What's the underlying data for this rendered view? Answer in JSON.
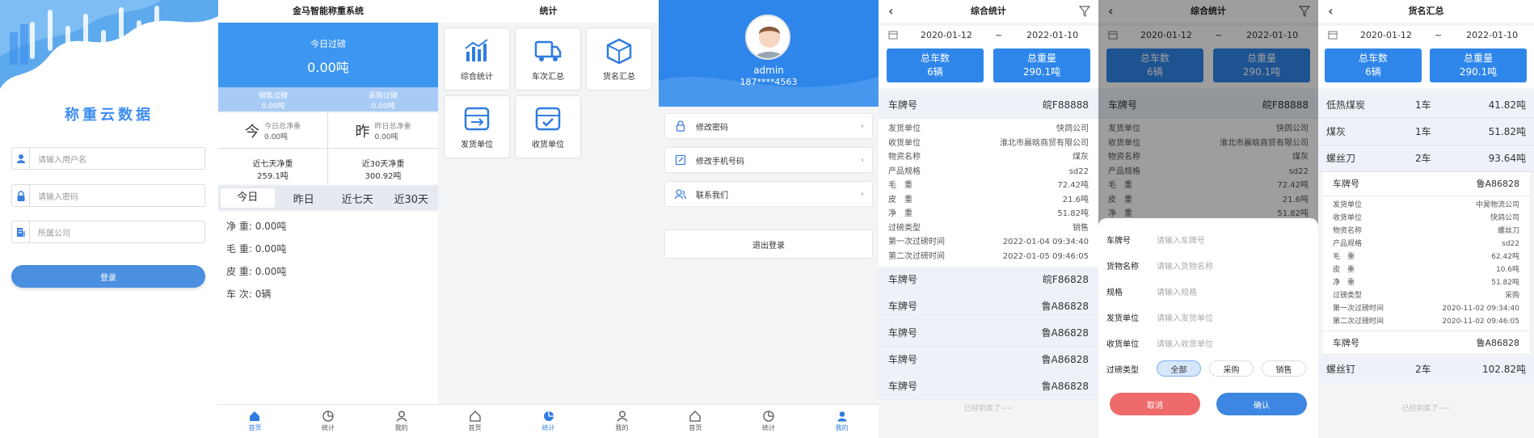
{
  "login": {
    "app_name": "称重云数据",
    "username_placeholder": "请输入用户名",
    "password_placeholder": "请输入密码",
    "company_placeholder": "所属公司",
    "login_button": "登录"
  },
  "home": {
    "title": "金马智能称重系统",
    "today_label": "今日过磅",
    "today_value": "0.00吨",
    "sales_label": "销售过磅",
    "sales_value": "0.00吨",
    "purchase_label": "采购过磅",
    "purchase_value": "0.00吨",
    "jin": "今",
    "today_net_label": "今日总净重",
    "today_net_value": "0.00吨",
    "zuo": "昨",
    "yest_net_label": "昨日总净重",
    "yest_net_value": "0.00吨",
    "week_net_label": "近七天净重",
    "week_net_value": "259.1吨",
    "month_net_label": "近30天净重",
    "month_net_value": "300.92吨",
    "tabs": [
      "今日",
      "昨日",
      "近七天",
      "近30天"
    ],
    "stats": [
      {
        "label": "净 重:",
        "value": "0.00吨"
      },
      {
        "label": "毛 重:",
        "value": "0.00吨"
      },
      {
        "label": "皮 重:",
        "value": "0.00吨"
      },
      {
        "label": "车 次:",
        "value": "0辆"
      }
    ]
  },
  "tabbar": {
    "home": "首页",
    "stats": "统计",
    "mine": "我的"
  },
  "stats_page": {
    "title": "统计",
    "cards": [
      "综合统计",
      "车次汇总",
      "货名汇总",
      "发货单位",
      "收货单位"
    ]
  },
  "profile": {
    "name": "admin",
    "phone": "187****4563",
    "menu": [
      "修改密码",
      "修改手机号码",
      "联系我们"
    ],
    "logout": "退出登录"
  },
  "overall": {
    "title": "综合统计",
    "date_start": "2020-01-12",
    "date_sep": "~",
    "date_end": "2022-01-10",
    "total_cars_label": "总车数",
    "total_cars_value": "6辆",
    "total_weight_label": "总重量",
    "total_weight_value": "290.1吨",
    "plate_label": "车牌号",
    "first_plate": "皖F88888",
    "details": [
      {
        "k": "发货单位",
        "v": "快鸽公司"
      },
      {
        "k": "收货单位",
        "v": "淮北市晨晗商贸有限公司"
      },
      {
        "k": "物资名称",
        "v": "煤灰"
      },
      {
        "k": "产品规格",
        "v": "sd22"
      },
      {
        "k": "毛　重",
        "v": "72.42吨"
      },
      {
        "k": "皮　重",
        "v": "21.6吨"
      },
      {
        "k": "净　重",
        "v": "51.82吨"
      },
      {
        "k": "过磅类型",
        "v": "销售"
      },
      {
        "k": "第一次过磅时间",
        "v": "2022-01-04 09:34:40"
      },
      {
        "k": "第二次过磅时间",
        "v": "2022-01-05 09:46:05"
      }
    ],
    "plates": [
      "皖F86828",
      "鲁A86828",
      "鲁A86828",
      "鲁A86828",
      "鲁A86828"
    ],
    "end_text": "已经到底了~~"
  },
  "filter": {
    "rows": [
      {
        "label": "车牌号",
        "placeholder": "请输入车牌号"
      },
      {
        "label": "货物名称",
        "placeholder": "请输入货物名称"
      },
      {
        "label": "规格",
        "placeholder": "请输入规格"
      },
      {
        "label": "发货单位",
        "placeholder": "请输入发货单位"
      },
      {
        "label": "收货单位",
        "placeholder": "请输入收货单位"
      }
    ],
    "type_label": "过磅类型",
    "types": [
      "全部",
      "采购",
      "销售"
    ],
    "cancel": "取消",
    "confirm": "确认"
  },
  "goods": {
    "title": "货名汇总",
    "items": [
      {
        "name": "低热煤炭",
        "count": "1车",
        "weight": "41.82吨"
      },
      {
        "name": "煤灰",
        "count": "1车",
        "weight": "51.82吨"
      },
      {
        "name": "螺丝刀",
        "count": "2车",
        "weight": "93.64吨"
      }
    ],
    "plate": "鲁A86828",
    "details": [
      {
        "k": "发货单位",
        "v": "中昊物流公司"
      },
      {
        "k": "收货单位",
        "v": "快鸽公司"
      },
      {
        "k": "物资名称",
        "v": "螺丝刀"
      },
      {
        "k": "产品规格",
        "v": "sd22"
      },
      {
        "k": "毛　重",
        "v": "62.42吨"
      },
      {
        "k": "皮　重",
        "v": "10.6吨"
      },
      {
        "k": "净　重",
        "v": "51.82吨"
      },
      {
        "k": "过磅类型",
        "v": "采购"
      },
      {
        "k": "第一次过磅时间",
        "v": "2020-11-02 09:34:40"
      },
      {
        "k": "第二次过磅时间",
        "v": "2020-11-02 09:46:05"
      }
    ],
    "plate2": "鲁A86828",
    "last_item": {
      "name": "螺丝钉",
      "count": "2车",
      "weight": "102.82吨"
    },
    "end_text": "已经到底了~~"
  }
}
